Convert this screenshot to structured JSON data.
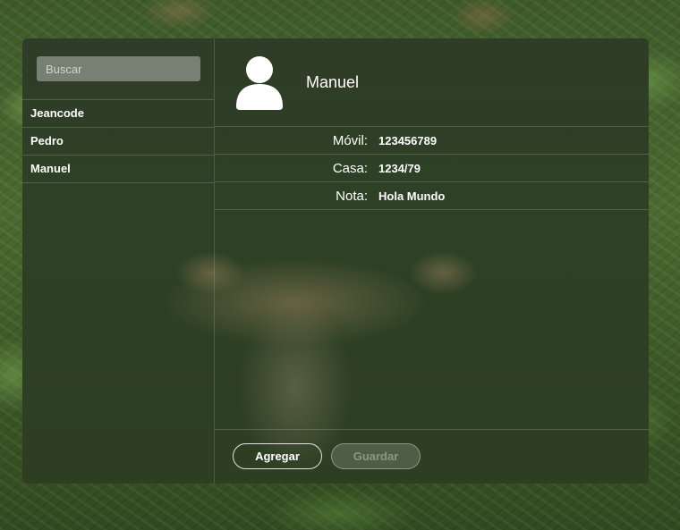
{
  "search": {
    "placeholder": "Buscar"
  },
  "contacts": [
    {
      "name": "Jeancode"
    },
    {
      "name": "Pedro"
    },
    {
      "name": "Manuel"
    }
  ],
  "selected": {
    "name": "Manuel",
    "avatar_icon": "user-silhouette-icon",
    "fields": [
      {
        "label": "Móvil:",
        "value": "123456789"
      },
      {
        "label": "Casa:",
        "value": "1234/79"
      },
      {
        "label": "Nota:",
        "value": "Hola Mundo"
      }
    ]
  },
  "actions": {
    "add_label": "Agregar",
    "save_label": "Guardar"
  }
}
